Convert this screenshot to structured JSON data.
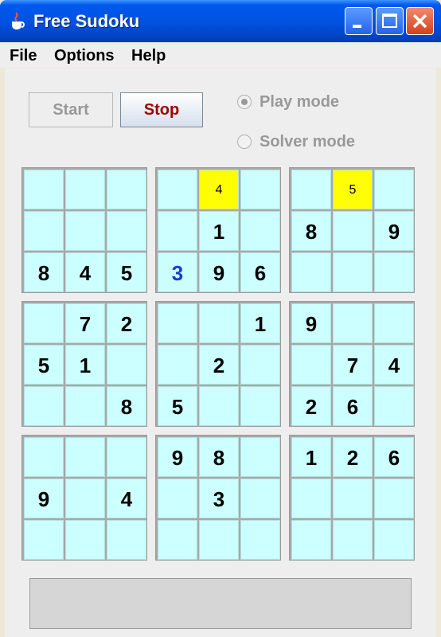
{
  "window": {
    "title": "Free Sudoku",
    "icon": "java-cup-icon"
  },
  "menu": [
    "File",
    "Options",
    "Help"
  ],
  "toolbar": {
    "start_label": "Start",
    "stop_label": "Stop"
  },
  "modes": [
    {
      "label": "Play mode",
      "selected": true
    },
    {
      "label": "Solver mode",
      "selected": false
    }
  ],
  "grid": [
    [
      "",
      "",
      "",
      "",
      "4",
      "",
      "",
      "5",
      ""
    ],
    [
      "",
      "",
      "",
      "",
      "1",
      "",
      "8",
      "",
      "9"
    ],
    [
      "8",
      "4",
      "5",
      "3",
      "9",
      "6",
      "",
      "",
      ""
    ],
    [
      "",
      "7",
      "2",
      "",
      "",
      "1",
      "9",
      "",
      ""
    ],
    [
      "5",
      "1",
      "",
      "",
      "2",
      "",
      "",
      "7",
      "4"
    ],
    [
      "",
      "",
      "8",
      "5",
      "",
      "",
      "2",
      "6",
      ""
    ],
    [
      "",
      "",
      "",
      "9",
      "8",
      "",
      "1",
      "2",
      "6"
    ],
    [
      "9",
      "",
      "4",
      "",
      "3",
      "",
      "",
      "",
      ""
    ],
    [
      "",
      "",
      "",
      "",
      "",
      "",
      "",
      "",
      ""
    ]
  ],
  "highlighted_cells": [
    [
      0,
      4
    ],
    [
      0,
      7
    ]
  ],
  "user_entered_cells": [
    [
      2,
      3
    ]
  ],
  "colors": {
    "cell": "#ccffff",
    "highlight": "#ffff00",
    "user_digit": "#1a3ccc",
    "stop_text": "#a00000"
  }
}
